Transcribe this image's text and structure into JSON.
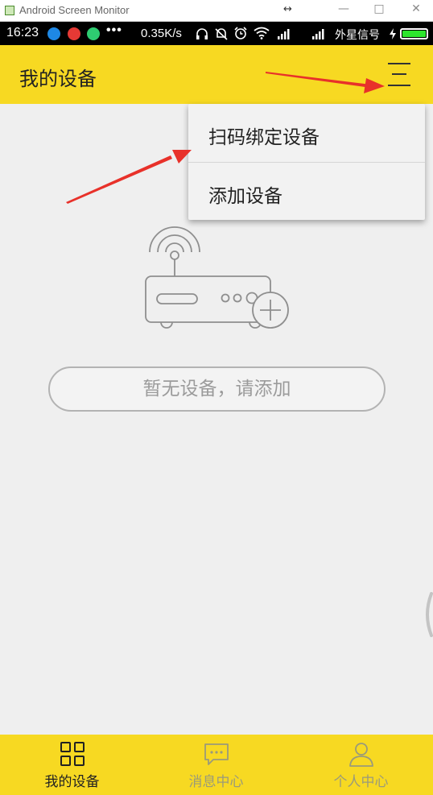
{
  "window": {
    "title": "Android Screen Monitor",
    "resize_glyph": "↔",
    "minimize_glyph": "—",
    "maximize_glyph": "□",
    "close_glyph": "✕"
  },
  "status_bar": {
    "time": "16:23",
    "overflow": "•••",
    "net_speed": "0.35K/s",
    "carrier": "外星信号",
    "battery_level": 1.0,
    "icons": [
      "usb-icon",
      "netease-music-icon",
      "wechat-icon",
      "headset-icon",
      "mute-icon",
      "alarm-icon",
      "wifi-icon",
      "signal-icon",
      "signal-icon",
      "charging-icon"
    ]
  },
  "header": {
    "title": "我的设备",
    "menu_icon": "menu-icon"
  },
  "dropdown": {
    "items": [
      {
        "label": "扫码绑定设备"
      },
      {
        "label": "添加设备"
      }
    ]
  },
  "empty_state": {
    "illustration": "router-add-icon",
    "button_label": "暂无设备，请添加"
  },
  "bottom_nav": {
    "tabs": [
      {
        "label": "我的设备",
        "icon": "grid-icon",
        "active": true
      },
      {
        "label": "消息中心",
        "icon": "message-icon",
        "active": false
      },
      {
        "label": "个人中心",
        "icon": "user-icon",
        "active": false
      }
    ]
  },
  "colors": {
    "accent_yellow": "#f7d922",
    "annotation_red": "#e8312a",
    "active_tab": "#222222",
    "inactive_tab": "#9a9a7a"
  }
}
